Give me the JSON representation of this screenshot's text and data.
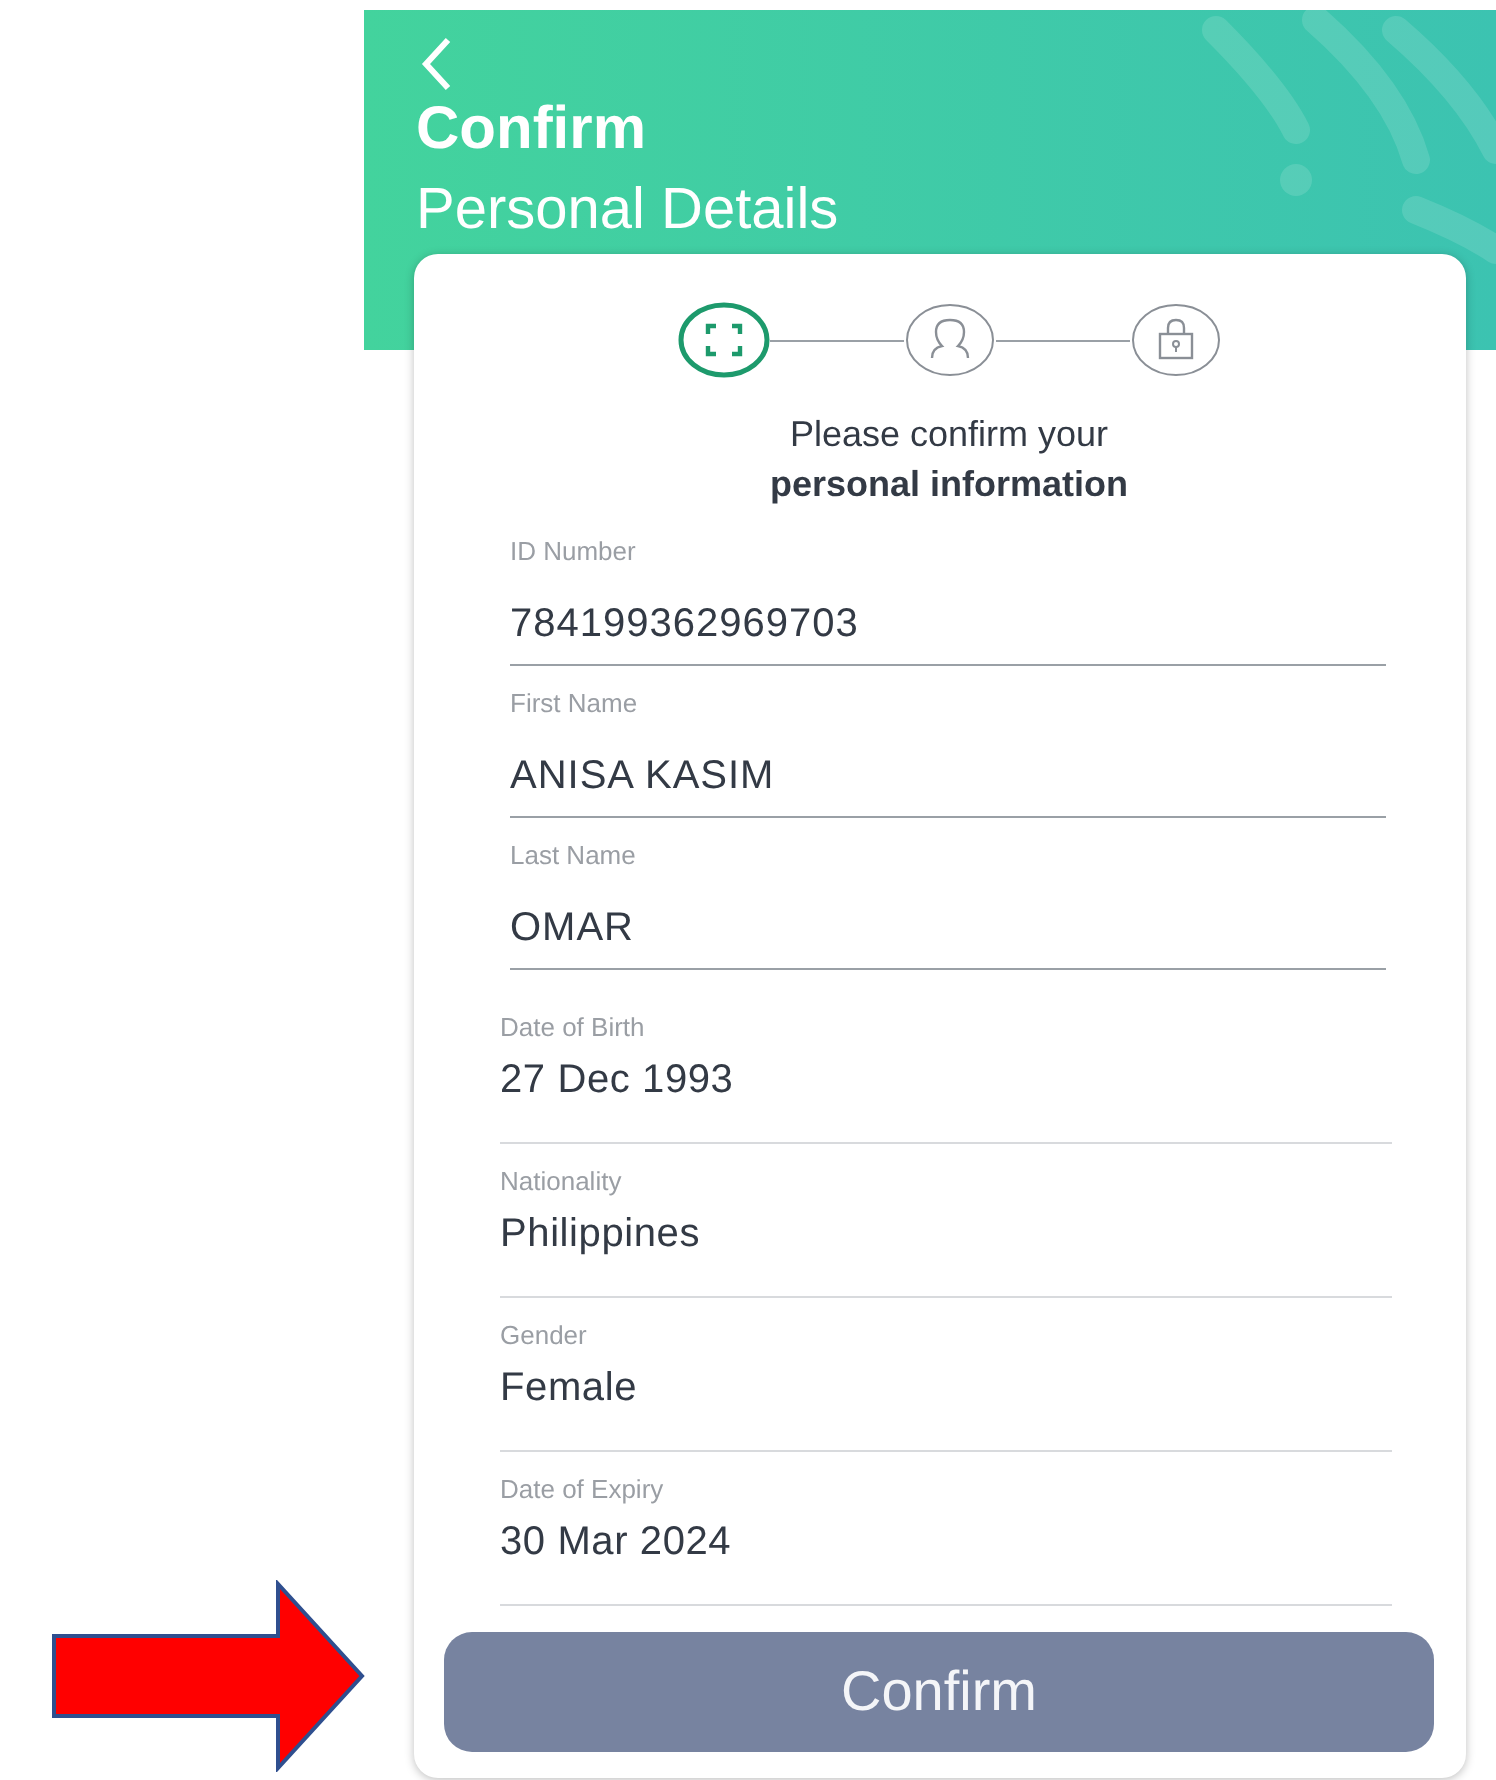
{
  "header": {
    "title": "Confirm",
    "subtitle": "Personal Details"
  },
  "steps": [
    {
      "kind": "scan",
      "selected": true
    },
    {
      "kind": "person",
      "selected": false
    },
    {
      "kind": "lock",
      "selected": false
    }
  ],
  "prompt": "Please confirm your\n**personal information**",
  "fields": [
    {
      "kind": "input",
      "label": "ID Number",
      "value": "784199362969703"
    },
    {
      "kind": "input",
      "label": "First Name",
      "value": "ANISA KASIM"
    },
    {
      "kind": "input",
      "label": "Last Name",
      "value": "OMAR"
    },
    {
      "kind": "row",
      "label": "Date of Birth",
      "value": "27 Dec 1993"
    },
    {
      "kind": "row",
      "label": "Nationality",
      "value": "Philippines"
    },
    {
      "kind": "row",
      "label": "Gender",
      "value": "Female"
    },
    {
      "kind": "row",
      "label": "Date of Expiry",
      "value": "30 Mar 2024"
    }
  ],
  "button": {
    "label": "Confirm"
  }
}
